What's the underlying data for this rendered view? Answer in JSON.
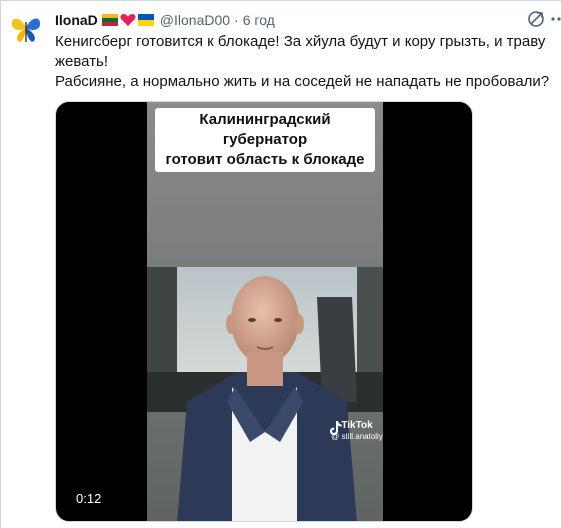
{
  "author": {
    "display_name": "IlonaD",
    "handle": "@IlonaD00",
    "separator": "·",
    "time": "6 год",
    "badges": [
      "flag-lithuania",
      "heart-red",
      "flag-ukraine"
    ],
    "avatar": "butterfly-avatar"
  },
  "actions": {
    "share_icon": "share-icon",
    "more_icon": "more-icon"
  },
  "tweet": {
    "line1": "Кенигсберг готовится к блокаде! За хйула будут и кору грызть, и траву жевать!",
    "line2": "Рабсияне, а нормально жить и на соседей не нападать не пробовали?"
  },
  "media": {
    "caption_line1": "Калининградский губернатор",
    "caption_line2": "готовит область к блокаде",
    "watermark_name": "TikTok",
    "watermark_handle": "@ still.anatoliy",
    "duration": "0:12"
  },
  "colors": {
    "text_primary": "#0f1419",
    "text_secondary": "#536471",
    "heart": "#f91880",
    "media_bg": "#000000"
  }
}
